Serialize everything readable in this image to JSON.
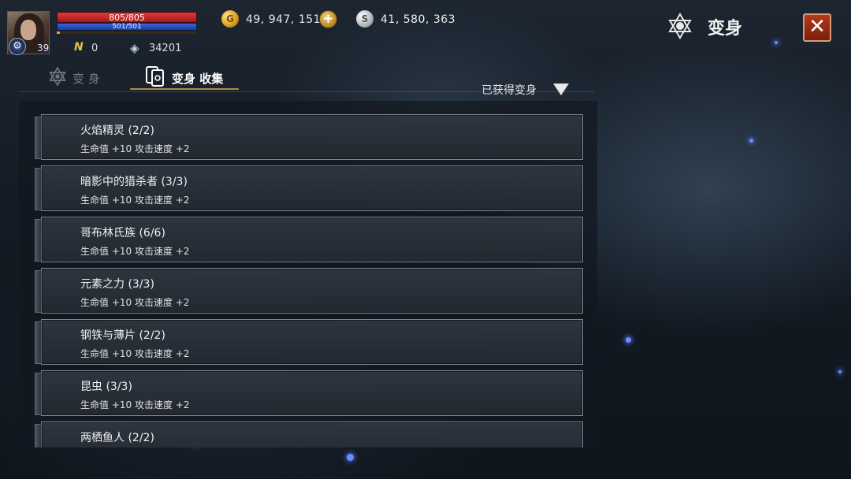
{
  "player": {
    "hp": "805/805",
    "mp": "501/501",
    "exp_fraction": 0.02,
    "level": "39",
    "n_points": "0",
    "power": "34201"
  },
  "currency": {
    "gold": "49, 947, 151",
    "silver": "41, 580, 363",
    "plus": "+"
  },
  "header": {
    "title": "变身",
    "close": "✕"
  },
  "tabs": [
    {
      "label": "变 身"
    },
    {
      "label": "变身 收集"
    }
  ],
  "filter": {
    "label": "已获得变身"
  },
  "collections": [
    {
      "name": "火焰精灵 (2/2)",
      "stats": "生命值 +10  攻击速度 +2"
    },
    {
      "name": "暗影中的猎杀者 (3/3)",
      "stats": "生命值 +10  攻击速度 +2"
    },
    {
      "name": "哥布林氏族 (6/6)",
      "stats": "生命值 +10  攻击速度 +2"
    },
    {
      "name": "元素之力 (3/3)",
      "stats": "生命值 +10  攻击速度 +2"
    },
    {
      "name": "钢铁与薄片 (2/2)",
      "stats": "生命值 +10  攻击速度 +2"
    },
    {
      "name": "昆虫 (3/3)",
      "stats": "生命值 +10  攻击速度 +2"
    },
    {
      "name": "两栖鱼人 (2/2)",
      "stats": ""
    }
  ],
  "icons": {
    "gold": "gold-coin-icon",
    "silver": "silver-coin-icon",
    "gem": "diamond-icon",
    "n": "n-currency-icon",
    "class": "gear-class-icon",
    "morph": "hexagram-icon",
    "collection": "card-stack-icon"
  },
  "colors": {
    "hp": "#c82020",
    "mp": "#2a4fc0",
    "close": "#9a2a12",
    "tab_accent": "#b38a4a"
  }
}
